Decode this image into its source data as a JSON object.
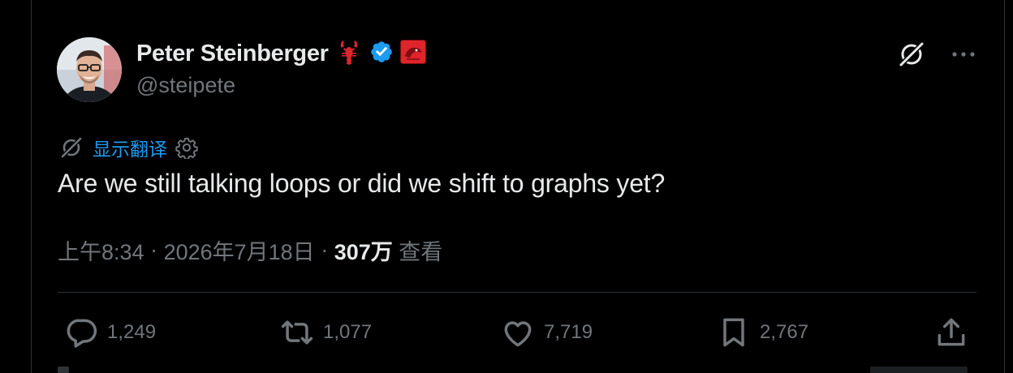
{
  "author": {
    "display_name": "Peter Steinberger",
    "handle": "@steipete",
    "emoji": "🦞"
  },
  "translate": {
    "label": "显示翻译"
  },
  "tweet": {
    "text": "Are we still talking loops or did we shift to graphs yet?"
  },
  "meta": {
    "time": "上午8:34",
    "separator": " · ",
    "date": "2026年7月18日",
    "views_count": "307万",
    "views_label": " 查看"
  },
  "actions": {
    "replies": "1,249",
    "reposts": "1,077",
    "likes": "7,719",
    "bookmarks": "2,767"
  },
  "icons": {
    "top_right": [
      "grok-icon",
      "more-icon"
    ],
    "badges": [
      "verified-badge-icon",
      "affiliate-badge-icon"
    ],
    "action_bar": [
      "reply-icon",
      "repost-icon",
      "like-icon",
      "bookmark-icon",
      "share-icon"
    ]
  },
  "colors": {
    "background": "#000000",
    "text": "#e7e9ea",
    "muted": "#71767b",
    "link": "#1d9bf0",
    "verified": "#1d9bf0",
    "affiliate_badge": "#e0242b",
    "divider": "#2f3336"
  }
}
